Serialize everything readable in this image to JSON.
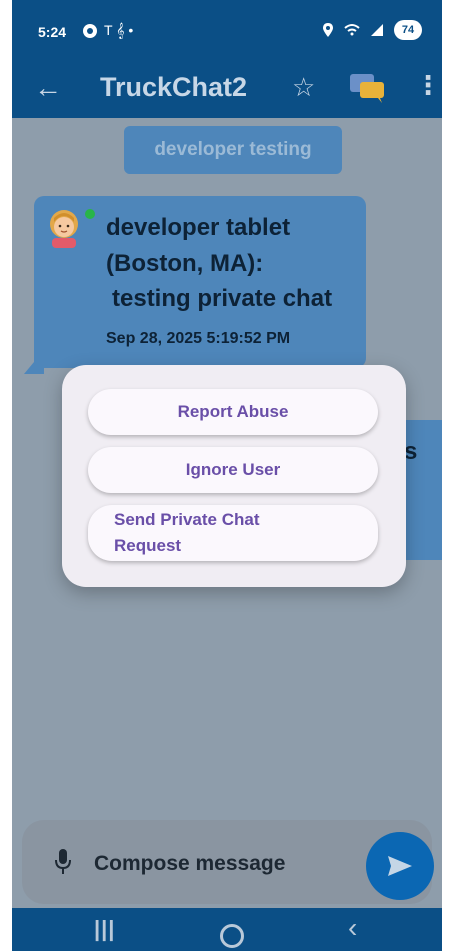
{
  "status_bar": {
    "time": "5:24",
    "left_icons": "T 𝄞 •",
    "battery": "74"
  },
  "app_bar": {
    "title": "TruckChat2",
    "back_icon": "arrow-left",
    "favorite_icon": "star-outline",
    "chat_icon": "chat-bubbles",
    "more_icon": "more-vertical"
  },
  "topic": {
    "label": "developer testing"
  },
  "message": {
    "sender": "developer tablet (Boston, MA):",
    "text": "testing private chat",
    "timestamp": "Sep 28, 2025 5:19:52 PM",
    "partial_right_text": "s"
  },
  "dialog": {
    "report_label": "Report Abuse",
    "ignore_label": "Ignore User",
    "private_label_line1": "Send Private Chat",
    "private_label_line2": "Request"
  },
  "compose": {
    "placeholder": "Compose message"
  },
  "nav_bar": {
    "recent_icon": "recent-apps",
    "home_icon": "home",
    "back_icon": "back"
  },
  "colors": {
    "primary": "#0b4f86",
    "bubble": "#4e86ba",
    "dialog_text": "#6a4fa8",
    "online": "#28b548"
  }
}
